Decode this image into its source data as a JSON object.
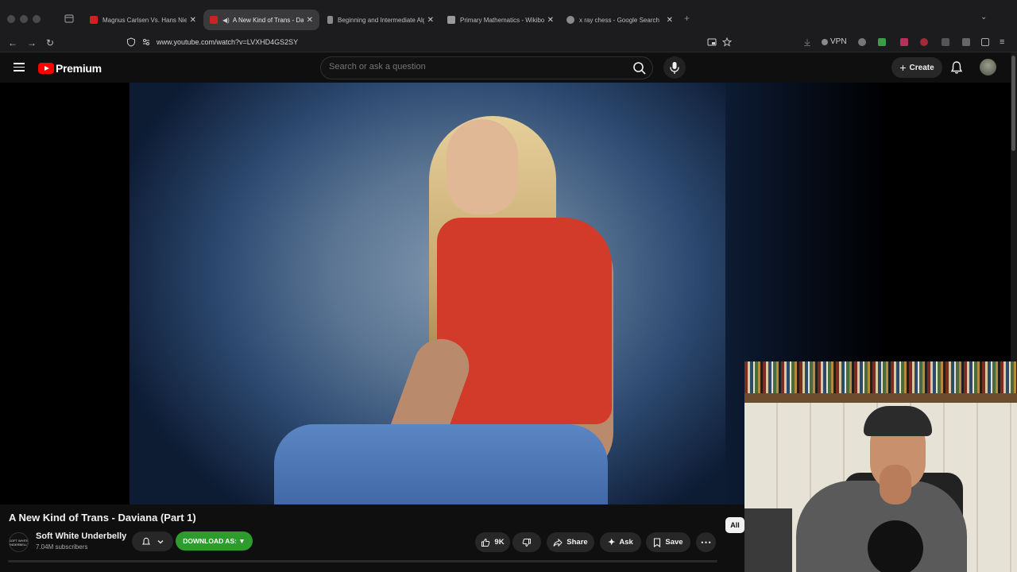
{
  "browser": {
    "tabs": [
      {
        "title": "Magnus Carlsen Vs. Hans Niem",
        "active": false,
        "favicon": "youtube-icon",
        "color": "#cc2222"
      },
      {
        "title": "A New Kind of Trans - Davia",
        "active": true,
        "favicon": "youtube-icon",
        "color": "#cc2222"
      },
      {
        "title": "Beginning and Intermediate Alg",
        "active": false,
        "favicon": "book-icon",
        "color": "#8a8a8a"
      },
      {
        "title": "Primary Mathematics - Wikiboo",
        "active": false,
        "favicon": "wikibooks-icon",
        "color": "#9a9a9a"
      },
      {
        "title": "x ray chess - Google Search",
        "active": false,
        "favicon": "google-icon",
        "color": "#8a8a8a"
      }
    ],
    "url": "www.youtube.com/watch?v=LVXHD4GS2SY",
    "vpn_label": "VPN"
  },
  "youtube": {
    "logo_text": "Premium",
    "search_placeholder": "Search or ask a question",
    "create_label": "Create"
  },
  "video": {
    "title": "A New Kind of Trans - Daviana (Part 1)",
    "channel_name": "Soft White Underbelly",
    "channel_avatar_text": "SOFT WHITE UNDERBELLY",
    "subscribers": "7.04M subscribers",
    "download_label": "DOWNLOAD AS: ▼",
    "likes": "9K",
    "share_label": "Share",
    "ask_label": "Ask",
    "save_label": "Save",
    "chip_all": "All"
  },
  "colors": {
    "accent_red": "#ff0000",
    "download_green": "#2d9c2d",
    "background": "#0f0f0f"
  }
}
